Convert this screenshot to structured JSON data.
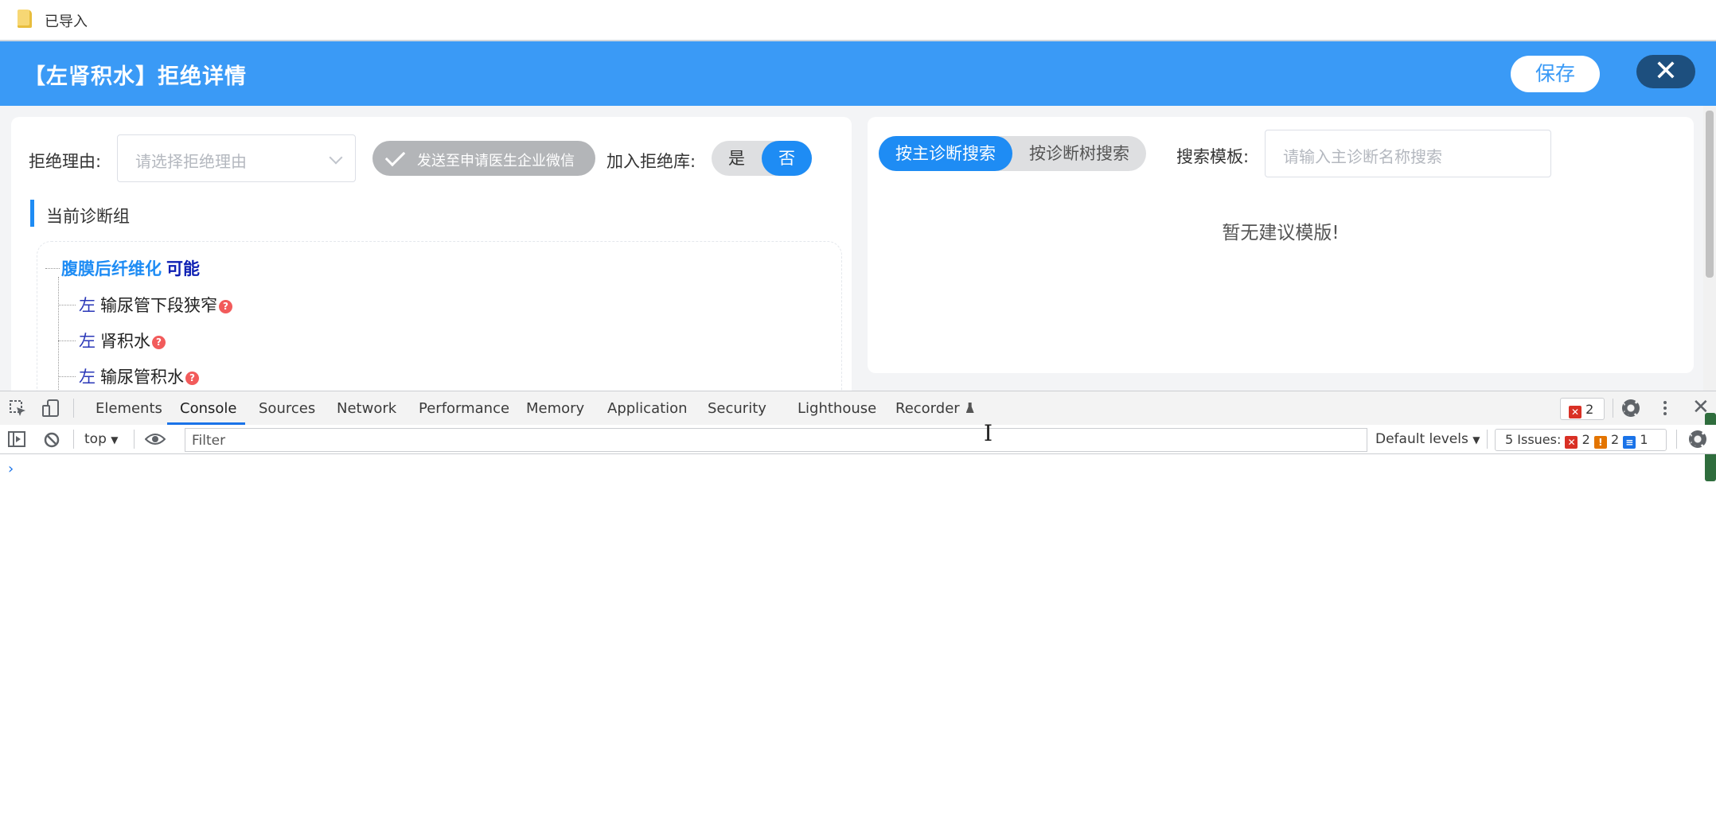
{
  "window": {
    "title": "已导入",
    "file_icon": "folder-file-icon"
  },
  "header": {
    "title": "【左肾积水】拒绝详情",
    "save_label": "保存",
    "close_icon": "close-icon",
    "close_symbol": "✕"
  },
  "left": {
    "reason_label": "拒绝理由:",
    "reason_placeholder": "请选择拒绝理由",
    "send_wechat_label": "发送至申请医生企业微信",
    "reject_db_label": "加入拒绝库:",
    "yes_label": "是",
    "no_label": "否",
    "selected": "否",
    "group_title": "当前诊断组",
    "tree": {
      "root": "腹膜后纤维化",
      "root_tag": "可能",
      "items": [
        {
          "side": "左",
          "name": "输尿管下段狭窄"
        },
        {
          "side": "左",
          "name": "肾积水"
        },
        {
          "side": "左",
          "name": "输尿管积水"
        }
      ],
      "question_mark": "?"
    }
  },
  "right": {
    "tab_main": "按主诊断搜索",
    "tab_tree": "按诊断树搜索",
    "active_tab": "按主诊断搜索",
    "template_label": "搜索模板:",
    "search_placeholder": "请输入主诊断名称搜索",
    "empty_message": "暂无建议模版!"
  },
  "devtools": {
    "tabs": [
      "Elements",
      "Console",
      "Sources",
      "Network",
      "Performance",
      "Memory",
      "Application",
      "Security",
      "Lighthouse",
      "Recorder"
    ],
    "active_tab": "Console",
    "error_count": "2",
    "context": "top",
    "filter_placeholder": "Filter",
    "levels": "Default levels",
    "issues_label": "5 Issues:",
    "issues_errors": "2",
    "issues_warnings": "2",
    "issues_info": "1",
    "prompt": "›",
    "x_symbol": "✕",
    "warn_symbol": "!",
    "info_symbol": "≡",
    "close_symbol": "✕",
    "dropdown_arrow": "▼"
  },
  "colors": {
    "accent": "#1e8cf4",
    "header_bg": "#3a9af6",
    "close_btn": "#1d4f7e",
    "error": "#d93025",
    "warning": "#e37400"
  }
}
